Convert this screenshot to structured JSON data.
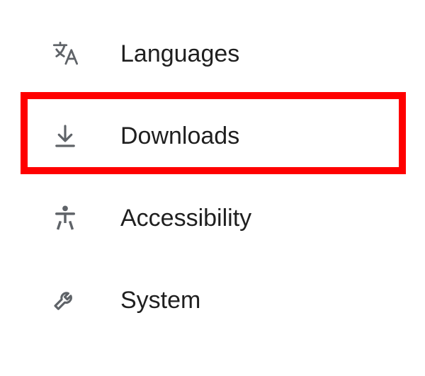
{
  "sidebar": {
    "items": [
      {
        "label": "Languages"
      },
      {
        "label": "Downloads"
      },
      {
        "label": "Accessibility"
      },
      {
        "label": "System"
      }
    ]
  },
  "highlight": {
    "target": "downloads",
    "color": "#ff0000"
  }
}
